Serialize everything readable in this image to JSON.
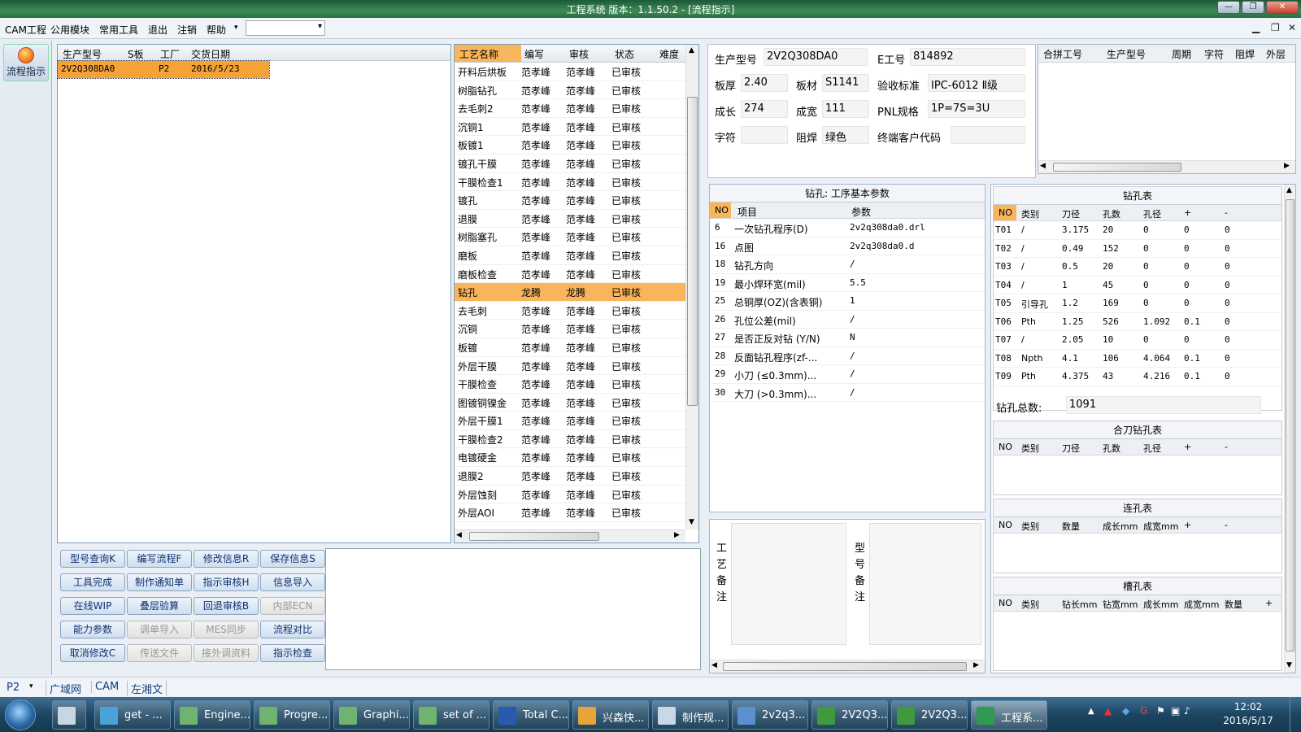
{
  "window": {
    "title": "工程系统   版本：1.1.50.2 - [流程指示]",
    "controls": [
      "—",
      "❐",
      "✕"
    ]
  },
  "menu": [
    "CAM工程",
    "公用模块",
    "常用工具",
    "退出",
    "注销",
    "帮助"
  ],
  "menu_combo": "",
  "left_nav": {
    "flow_label": "流程指示"
  },
  "orders": {
    "headers": [
      "生产型号",
      "S板",
      "工厂",
      "交货日期"
    ],
    "rows": [
      {
        "model": "2V2Q308DA0",
        "s": "",
        "factory": "P2",
        "date": "2016/5/23"
      }
    ]
  },
  "process": {
    "headers": [
      "工艺名称",
      "编写",
      "审核",
      "状态",
      "难度"
    ],
    "rows": [
      [
        "开料后烘板",
        "范孝峰",
        "范孝峰",
        "已审核",
        ""
      ],
      [
        "树脂钻孔",
        "范孝峰",
        "范孝峰",
        "已审核",
        ""
      ],
      [
        "去毛刺2",
        "范孝峰",
        "范孝峰",
        "已审核",
        ""
      ],
      [
        "沉铜1",
        "范孝峰",
        "范孝峰",
        "已审核",
        ""
      ],
      [
        "板镀1",
        "范孝峰",
        "范孝峰",
        "已审核",
        ""
      ],
      [
        "镀孔干膜",
        "范孝峰",
        "范孝峰",
        "已审核",
        ""
      ],
      [
        "干膜检查1",
        "范孝峰",
        "范孝峰",
        "已审核",
        ""
      ],
      [
        "镀孔",
        "范孝峰",
        "范孝峰",
        "已审核",
        ""
      ],
      [
        "退膜",
        "范孝峰",
        "范孝峰",
        "已审核",
        ""
      ],
      [
        "树脂塞孔",
        "范孝峰",
        "范孝峰",
        "已审核",
        ""
      ],
      [
        "磨板",
        "范孝峰",
        "范孝峰",
        "已审核",
        ""
      ],
      [
        "磨板检查",
        "范孝峰",
        "范孝峰",
        "已审核",
        ""
      ],
      [
        "钻孔",
        "龙腾",
        "龙腾",
        "已审核",
        ""
      ],
      [
        "去毛刺",
        "范孝峰",
        "范孝峰",
        "已审核",
        ""
      ],
      [
        "沉铜",
        "范孝峰",
        "范孝峰",
        "已审核",
        ""
      ],
      [
        "板镀",
        "范孝峰",
        "范孝峰",
        "已审核",
        ""
      ],
      [
        "外层干膜",
        "范孝峰",
        "范孝峰",
        "已审核",
        ""
      ],
      [
        "干膜检查",
        "范孝峰",
        "范孝峰",
        "已审核",
        ""
      ],
      [
        "图镀铜镍金",
        "范孝峰",
        "范孝峰",
        "已审核",
        ""
      ],
      [
        "外层干膜1",
        "范孝峰",
        "范孝峰",
        "已审核",
        ""
      ],
      [
        "干膜检查2",
        "范孝峰",
        "范孝峰",
        "已审核",
        ""
      ],
      [
        "电镀硬金",
        "范孝峰",
        "范孝峰",
        "已审核",
        ""
      ],
      [
        "退膜2",
        "范孝峰",
        "范孝峰",
        "已审核",
        ""
      ],
      [
        "外层蚀刻",
        "范孝峰",
        "范孝峰",
        "已审核",
        ""
      ],
      [
        "外层AOI",
        "范孝峰",
        "范孝峰",
        "已审核",
        ""
      ]
    ]
  },
  "buttons": [
    [
      "型号查询K",
      "编写流程F",
      "修改信息R",
      "保存信息S"
    ],
    [
      "工具完成",
      "制作通知单",
      "指示审核H",
      "信息导入"
    ],
    [
      "在线WIP",
      "叠层验算",
      "回退审核B",
      "内部ECN"
    ],
    [
      "能力参数",
      "调单导入",
      "MES同步",
      "流程对比"
    ],
    [
      "取消修改C",
      "传送文件",
      "接外调资料",
      "指示检查"
    ]
  ],
  "buttons_disabled": [
    "内部ECN",
    "调单导入",
    "MES同步",
    "传送文件",
    "接外调资料"
  ],
  "info": {
    "model_label": "生产型号",
    "model": "2V2Q308DA0",
    "eno_label": "E工号",
    "eno": "814892",
    "thick_label": "板厚",
    "thick": "2.40",
    "mat_label": "板材",
    "mat": "S1141",
    "std_label": "验收标准",
    "std": "IPC-6012 Ⅱ级",
    "len_label": "成长",
    "len": "274",
    "wid_label": "成宽",
    "wid": "111",
    "pnl_label": "PNL规格",
    "pnl": "1P=7S=3U",
    "char_label": "字符",
    "char": "",
    "mask_label": "阻焊",
    "mask": "绿色",
    "cust_label": "终端客户代码",
    "cust": ""
  },
  "combine": {
    "headers": [
      "合拼工号",
      "生产型号",
      "周期",
      "字符",
      "阻焊",
      "外层"
    ]
  },
  "params": {
    "title": "钻孔: 工序基本参数",
    "headers": [
      "NO",
      "项目",
      "参数"
    ],
    "rows": [
      [
        "6",
        "一次钻孔程序(D)",
        "2v2q308da0.drl"
      ],
      [
        "16",
        "点图",
        "2v2q308da0.d"
      ],
      [
        "18",
        "钻孔方向",
        "/"
      ],
      [
        "19",
        "最小焊环宽(mil)",
        "5.5"
      ],
      [
        "25",
        "总铜厚(OZ)(含表铜)",
        "1"
      ],
      [
        "26",
        "孔位公差(mil)",
        "/"
      ],
      [
        "27",
        "是否正反对钻 (Y/N)",
        "N"
      ],
      [
        "28",
        "反面钻孔程序(zf-...",
        "/"
      ],
      [
        "29",
        "小刀 (≤0.3mm)...",
        "/"
      ],
      [
        "30",
        "大刀 (>0.3mm)...",
        "/"
      ]
    ]
  },
  "remarks": {
    "process_label": "工艺备注",
    "model_label": "型号备注"
  },
  "drill": {
    "title": "钻孔表",
    "headers": [
      "NO",
      "类别",
      "刀径",
      "孔数",
      "孔径",
      "+",
      "-"
    ],
    "rows": [
      [
        "T01",
        "/",
        "3.175",
        "20",
        "0",
        "0",
        "0"
      ],
      [
        "T02",
        "/",
        "0.49",
        "152",
        "0",
        "0",
        "0"
      ],
      [
        "T03",
        "/",
        "0.5",
        "20",
        "0",
        "0",
        "0"
      ],
      [
        "T04",
        "/",
        "1",
        "45",
        "0",
        "0",
        "0"
      ],
      [
        "T05",
        "引导孔",
        "1.2",
        "169",
        "0",
        "0",
        "0"
      ],
      [
        "T06",
        "Pth",
        "1.25",
        "526",
        "1.092",
        "0.1",
        "0"
      ],
      [
        "T07",
        "/",
        "2.05",
        "10",
        "0",
        "0",
        "0"
      ],
      [
        "T08",
        "Npth",
        "4.1",
        "106",
        "4.064",
        "0.1",
        "0"
      ],
      [
        "T09",
        "Pth",
        "4.375",
        "43",
        "4.216",
        "0.1",
        "0"
      ]
    ],
    "total_label": "钻孔总数:",
    "total": "1091"
  },
  "knife": {
    "title": "合刀钻孔表",
    "headers": [
      "NO",
      "类别",
      "刀径",
      "孔数",
      "孔径",
      "+",
      "-"
    ]
  },
  "lian": {
    "title": "连孔表",
    "headers": [
      "NO",
      "类别",
      "数量",
      "成长mm",
      "成宽mm",
      "+",
      "-"
    ]
  },
  "cao": {
    "title": "槽孔表",
    "headers": [
      "NO",
      "类别",
      "钻长mm",
      "钻宽mm",
      "成长mm",
      "成宽mm",
      "数量",
      "+"
    ]
  },
  "status": {
    "factory": "P2",
    "tabs": [
      "广域网",
      "CAM",
      "左湘文"
    ]
  },
  "taskbar": {
    "items": [
      "get - ...",
      "Engine...",
      "Progre...",
      "Graphi...",
      "set of ...",
      "Total C...",
      "兴森快...",
      "制作规...",
      "2v2q3...",
      "2V2Q3...",
      "2V2Q3...",
      "工程系..."
    ],
    "time": "12:02",
    "date": "2016/5/17"
  },
  "colors": {
    "highlight": "#f9b55b",
    "title_bar": "#2f7a4a",
    "taskbar": "#1d4562"
  }
}
